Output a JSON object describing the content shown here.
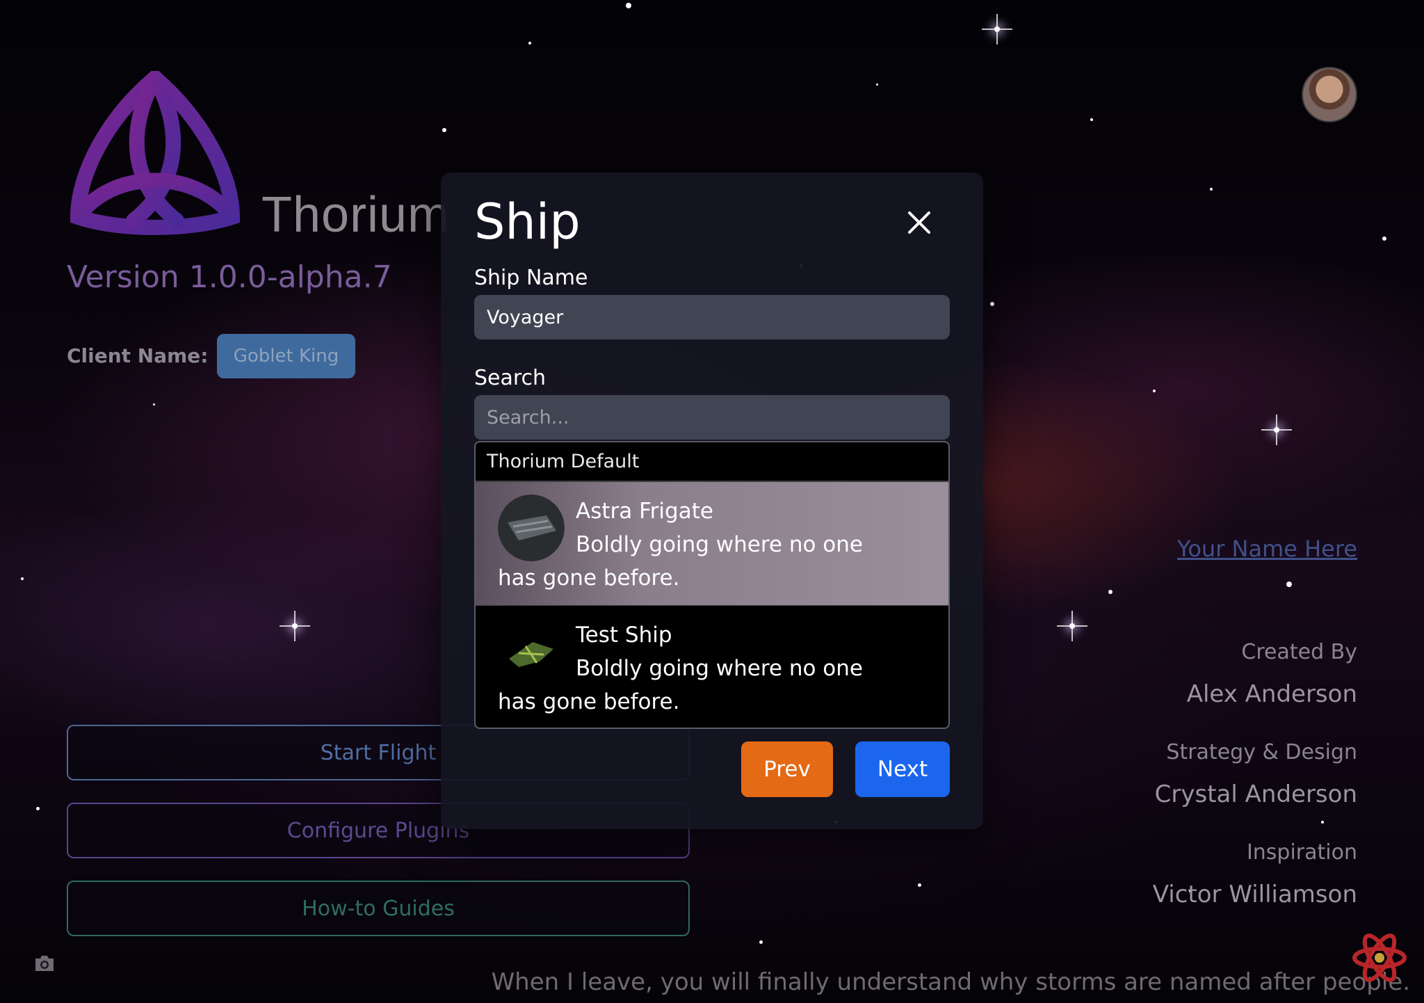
{
  "app": {
    "title": "Thorium",
    "version": "Version 1.0.0-alpha.7"
  },
  "client": {
    "label": "Client Name:",
    "name_button": "Goblet King"
  },
  "menu": {
    "start_flight": "Start Flight",
    "configure_plugins": "Configure Plugins",
    "howto_guides": "How-to Guides"
  },
  "credits": {
    "your_name_link": "Your Name Here",
    "entries": [
      {
        "role": "Created By",
        "name": "Alex Anderson"
      },
      {
        "role": "Strategy & Design",
        "name": "Crystal Anderson"
      },
      {
        "role": "Inspiration",
        "name": "Victor Williamson"
      }
    ],
    "quote": "When I leave, you will finally understand why storms are named after people."
  },
  "modal": {
    "title": "Ship",
    "ship_name_label": "Ship Name",
    "ship_name_value": "Voyager",
    "search_label": "Search",
    "search_placeholder": "Search...",
    "group_header": "Thorium Default",
    "results": [
      {
        "name": "Astra Frigate",
        "description": "Boldly going where no one has gone before.",
        "selected": true
      },
      {
        "name": "Test Ship",
        "description": "Boldly going where no one has gone before.",
        "selected": false
      }
    ],
    "prev_label": "Prev",
    "next_label": "Next"
  },
  "icons": {
    "logo": "thorium-triquetra-logo",
    "close": "close-icon",
    "camera": "camera-icon",
    "react": "react-atom-icon"
  },
  "colors": {
    "prev_button": "#e46a16",
    "next_button": "#1c66ee",
    "client_button": "#3f6a9e",
    "logo_purple": "#7a2a9e"
  }
}
